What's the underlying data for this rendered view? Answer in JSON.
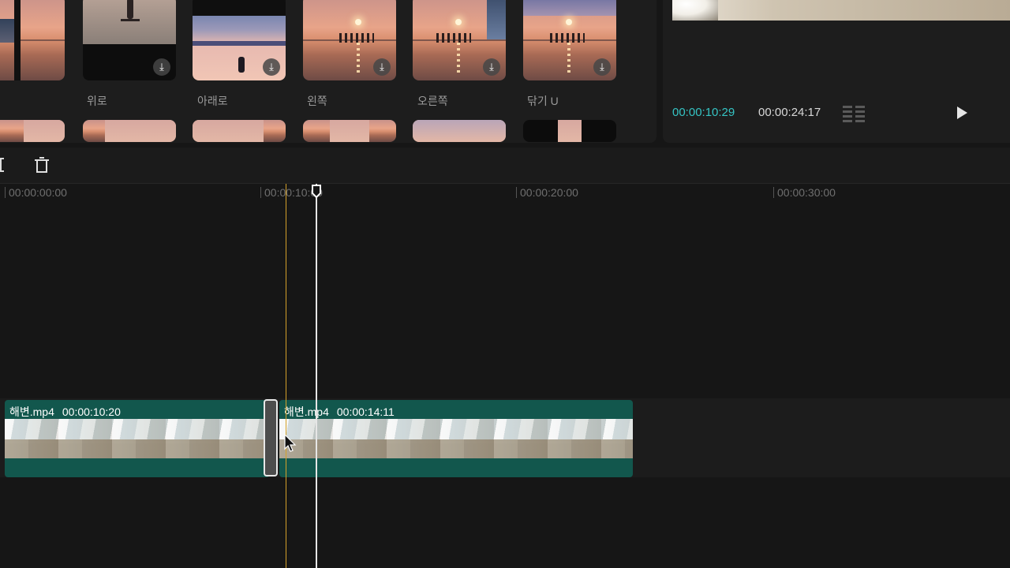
{
  "effects": {
    "labels": [
      "위로",
      "아래로",
      "왼쪽",
      "오른쪽",
      "닦기 U"
    ],
    "download_icon": "download-icon"
  },
  "preview": {
    "time_current": "00:00:10:29",
    "time_total": "00:00:24:17",
    "fit_icon": "grid-icon",
    "play_icon": "play-icon"
  },
  "toolbar": {
    "split_icon": "split-icon",
    "delete_icon": "trash-icon"
  },
  "timeline": {
    "ruler": [
      "00:00:00:00",
      "00:00:10:00",
      "00:00:20:00",
      "00:00:30:00"
    ],
    "clips": [
      {
        "name": "해변.mp4",
        "duration": "00:00:10:20"
      },
      {
        "name": "해변.mp4",
        "duration": "00:00:14:11"
      }
    ]
  },
  "colors": {
    "accent_time": "#35c4c4",
    "clip_bg": "#12574d",
    "hover_line": "#d4a12a"
  }
}
